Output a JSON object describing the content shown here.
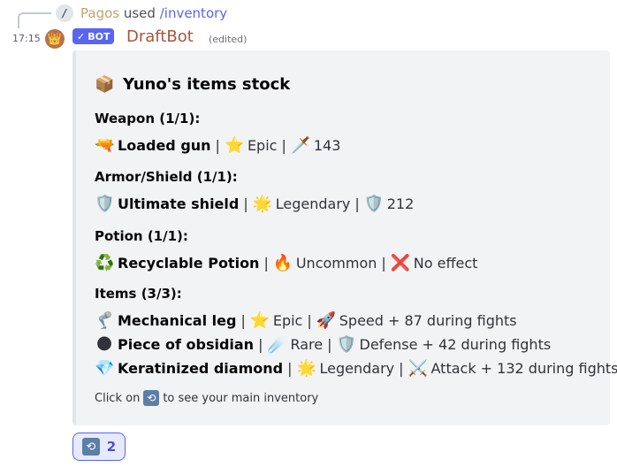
{
  "reply": {
    "icon": "/",
    "user": "Pagos",
    "verb": "used",
    "command": "/inventory"
  },
  "header": {
    "time": "17:15",
    "bot_tag": "BOT",
    "username": "DraftBot",
    "edited": "(edited)"
  },
  "embed": {
    "title_emoji": "📦",
    "title": "Yuno's items stock",
    "sections": [
      {
        "heading": "Weapon (1/1):",
        "items": [
          {
            "icon": "🔫",
            "name": "Loaded gun",
            "rarity_icon": "⭐",
            "rarity": "Epic",
            "stat_icon": "🗡️",
            "stat": "143"
          }
        ]
      },
      {
        "heading": "Armor/Shield (1/1):",
        "items": [
          {
            "icon": "🛡️",
            "name": "Ultimate shield",
            "rarity_icon": "🌟",
            "rarity": "Legendary",
            "stat_icon": "🛡️",
            "stat": "212"
          }
        ]
      },
      {
        "heading": "Potion (1/1):",
        "items": [
          {
            "icon": "♻️",
            "name": "Recyclable Potion",
            "rarity_icon": "🔥",
            "rarity": "Uncommon",
            "stat_icon": "❌",
            "stat": "No effect"
          }
        ]
      },
      {
        "heading": "Items (3/3):",
        "items": [
          {
            "icon": "🦿",
            "name": "Mechanical leg",
            "rarity_icon": "⭐",
            "rarity": "Epic",
            "stat_icon": "🚀",
            "stat": "Speed + 87 during fights"
          },
          {
            "icon": "🌑",
            "name": "Piece of obsidian",
            "rarity_icon": "☄️",
            "rarity": "Rare",
            "stat_icon": "🛡️",
            "stat": "Defense + 42 during fights"
          },
          {
            "icon": "💎",
            "name": "Keratinized diamond",
            "rarity_icon": "🌟",
            "rarity": "Legendary",
            "stat_icon": "⚔️",
            "stat": "Attack + 132 during fights"
          }
        ]
      }
    ],
    "footer_before": "Click on",
    "footer_icon": "🔃",
    "footer_after": "to see your main inventory"
  },
  "reaction": {
    "icon": "🔃",
    "count": "2"
  },
  "colors": {
    "blurple": "#5865f2",
    "username": "#a8563b",
    "reply_user": "#c4a36a",
    "embed_bg": "#f2f3f5"
  }
}
